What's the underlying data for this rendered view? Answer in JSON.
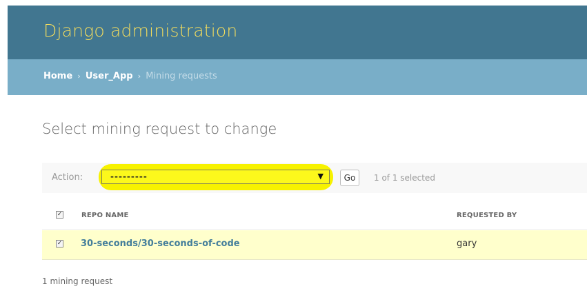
{
  "header": {
    "title": "Django administration"
  },
  "breadcrumbs": {
    "home": "Home",
    "separator": "›",
    "app": "User_App",
    "current": "Mining requests"
  },
  "page": {
    "title": "Select mining request to change"
  },
  "actions": {
    "label": "Action:",
    "selected_option": "---------",
    "go_label": "Go",
    "selection_counter": "1 of 1 selected"
  },
  "table": {
    "columns": [
      "REPO NAME",
      "REQUESTED BY"
    ],
    "rows": [
      {
        "repo_name": "30-seconds/30-seconds-of-code",
        "requested_by": "gary",
        "selected": true
      }
    ]
  },
  "paginator": {
    "text": "1 mining request"
  },
  "colors": {
    "header_bg": "#417690",
    "title_yellow": "#f5dd5d",
    "breadcrumb_bg": "#79aec8",
    "highlight": "#f7f200",
    "selected_row": "#ffffcc",
    "link": "#447e9b"
  }
}
